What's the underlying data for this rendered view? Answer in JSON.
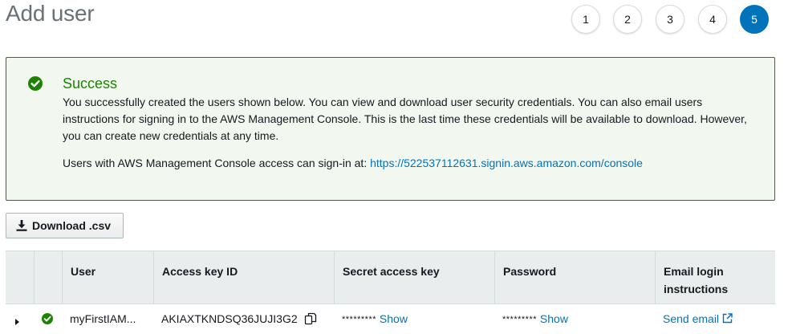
{
  "page": {
    "title": "Add user"
  },
  "steps": [
    {
      "label": "1",
      "active": false
    },
    {
      "label": "2",
      "active": false
    },
    {
      "label": "3",
      "active": false
    },
    {
      "label": "4",
      "active": false
    },
    {
      "label": "5",
      "active": true
    }
  ],
  "alert": {
    "title": "Success",
    "body": "You successfully created the users shown below. You can view and download user security credentials. You can also email users instructions for signing in to the AWS Management Console. This is the last time these credentials will be available to download. However, you can create new credentials at any time.",
    "console_prefix": "Users with AWS Management Console access can sign-in at: ",
    "console_url": "https://522537112631.signin.aws.amazon.com/console",
    "icon": "check-circle-icon",
    "color": "#1d8102"
  },
  "toolbar": {
    "download_label": "Download .csv",
    "download_icon": "download-icon"
  },
  "table": {
    "headers": {
      "user": "User",
      "access_key_id": "Access key ID",
      "secret_access_key": "Secret access key",
      "password": "Password",
      "email_line1": "Email login",
      "email_line2": "instructions"
    },
    "rows": [
      {
        "user": "myFirstIAM...",
        "access_key_id": "AKIAXTKNDSQ36JUJI3G2",
        "secret_masked": "*********",
        "secret_show": "Show",
        "password_masked": "*********",
        "password_show": "Show",
        "email_action": "Send email"
      }
    ]
  },
  "colors": {
    "accent": "#0073bb",
    "success": "#1d8102",
    "header_bg": "#eaeded"
  }
}
